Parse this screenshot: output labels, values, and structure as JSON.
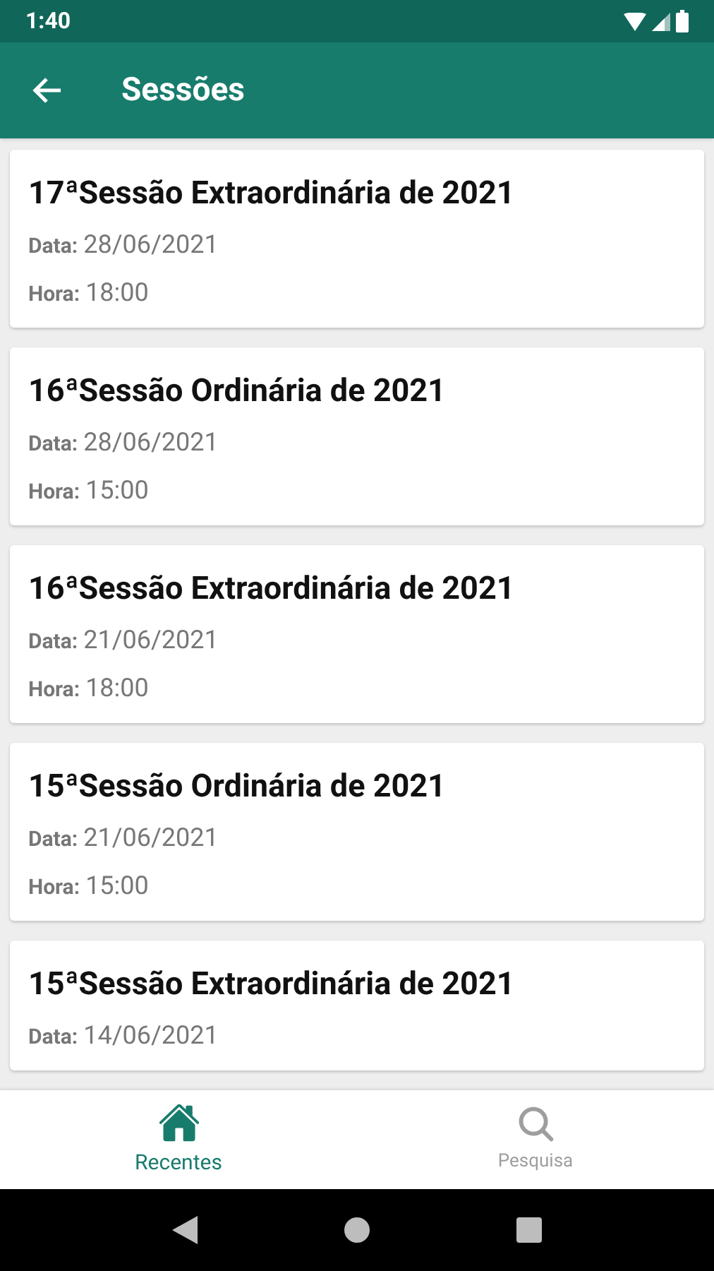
{
  "status_bar": {
    "time": "1:40"
  },
  "app_bar": {
    "title": "Sessões"
  },
  "sessions": [
    {
      "title": "17ªSessão Extraordinária de 2021",
      "date_label": "Data:",
      "date": "28/06/2021",
      "time_label": "Hora:",
      "time": "18:00"
    },
    {
      "title": "16ªSessão Ordinária de 2021",
      "date_label": "Data:",
      "date": "28/06/2021",
      "time_label": "Hora:",
      "time": "15:00"
    },
    {
      "title": "16ªSessão Extraordinária de 2021",
      "date_label": "Data:",
      "date": "21/06/2021",
      "time_label": "Hora:",
      "time": "18:00"
    },
    {
      "title": "15ªSessão Ordinária de 2021",
      "date_label": "Data:",
      "date": "21/06/2021",
      "time_label": "Hora:",
      "time": "15:00"
    },
    {
      "title": "15ªSessão Extraordinária de 2021",
      "date_label": "Data:",
      "date": "14/06/2021"
    }
  ],
  "bottom_nav": [
    {
      "kind": "home",
      "label": "Recentes",
      "selected": true
    },
    {
      "kind": "search",
      "label": "Pesquisa",
      "selected": false
    }
  ]
}
